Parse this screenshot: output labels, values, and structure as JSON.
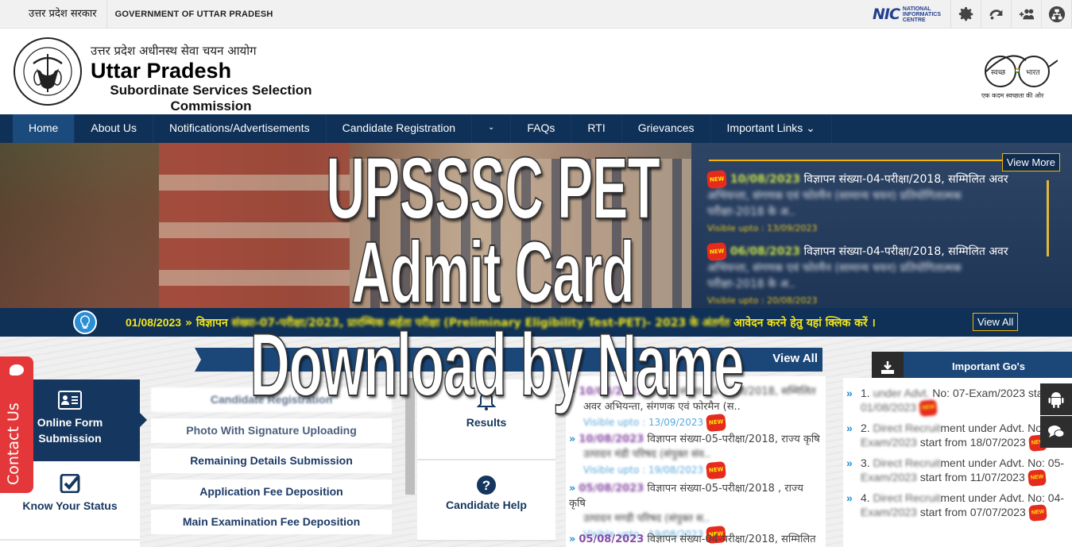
{
  "gov_bar": {
    "hindi": "उत्तर प्रदेश सरकार",
    "english": "GOVERNMENT OF UTTAR PRADESH",
    "nic_mark": "NIC",
    "nic_text": [
      "NATIONAL",
      "INFORMATICS",
      "CENTRE"
    ],
    "tools": [
      "settings-icon",
      "skip-to-content-icon",
      "add-user-icon",
      "sitemap-icon"
    ]
  },
  "header": {
    "hindi_title": "उत्तर प्रदेश अधीनस्थ सेवा चयन आयोग",
    "title": "Uttar Pradesh",
    "subtitle": "Subordinate Services Selection Commission",
    "emblem_text": "उत्तर प्रदेश सरकार",
    "swachh": {
      "left": "स्वच्छ",
      "right": "भारत",
      "tagline": "एक कदम स्वच्छता की ओर"
    }
  },
  "nav": {
    "items": [
      {
        "label": "Home",
        "active": true
      },
      {
        "label": "About Us"
      },
      {
        "label": "Notifications/Advertisements"
      },
      {
        "label": "Candidate Registration"
      },
      {
        "label": "⌄"
      },
      {
        "label": "FAQs"
      },
      {
        "label": "RTI"
      },
      {
        "label": "Grievances"
      },
      {
        "label": "Important Links ⌄"
      }
    ]
  },
  "banner": {
    "view_more": "View More",
    "news": [
      {
        "date": "10/08/2023",
        "text": "विज्ञापन संख्या-04-परीक्षा/2018, सम्मिलित अवर",
        "text2": "अभियन्ता, संगणक एवं फोरमैन (सामान्य चयन) प्रतियोगितात्मक",
        "text3": "परीक्षा-2018 के अ..",
        "visible": "Visible upto : 13/09/2023",
        "badge": "NEW"
      },
      {
        "date": "06/08/2023",
        "text": "विज्ञापन संख्या-04-परीक्षा/2018, सम्मिलित अवर",
        "text2": "अभियन्ता, संगणक एवं फोरमैन (सामान्य चयन) प्रतियोगितात्मक",
        "text3": "परीक्षा-2018 के अ..",
        "visible": "Visible upto : 20/08/2023",
        "badge": "NEW"
      }
    ]
  },
  "ticker": {
    "date": "01/08/2023",
    "sep": "»",
    "text_start": "विज्ञापन",
    "text_blur": "संख्या-07-परीक्षा/2023, प्रारम्भिक अर्हता परीक्षा (Preliminary Eligibility Test-PET)- 2023 के अंतर्गत",
    "text_end": "आवेदन करने हेतु यहां क्लिक करें ।",
    "view_all": "View All"
  },
  "contact": {
    "label": "Contact Us"
  },
  "tabs": [
    {
      "label_line1": "Online Form",
      "label_line2": "Submission",
      "icon": "id-card-icon",
      "active": true
    },
    {
      "label_line1": "Know Your Status",
      "label_line2": "",
      "icon": "checkbox-icon"
    }
  ],
  "submenu": [
    "Candidate Registration",
    "Photo With Signature Uploading",
    "Remaining Details Submission",
    "Application Fee Deposition",
    "Main Examination Fee Deposition"
  ],
  "cards": [
    {
      "label": "Results",
      "icon": "bell-icon"
    },
    {
      "label": "Candidate Help",
      "icon": "question-icon"
    }
  ],
  "notices": {
    "view_all": "View All",
    "items": [
      {
        "date": "10/08/2023",
        "text": "विज्ञापन संख्या-04-परीक्षा/2018, सम्मिलित",
        "text2": "अवर अभियन्ता, संगणक एवं फोरमैन (स..",
        "visible_label": "Visible upto :",
        "visible_date": "13/09/2023",
        "badge": "NEW"
      },
      {
        "date": "10/08/2023",
        "text": "विज्ञापन संख्या-05-परीक्षा/2018, राज्य कृषि",
        "text2": "उत्पादन मंडी परिषद (संपुक्त संव..",
        "visible_label": "Visible upto :",
        "visible_date": "19/08/2023",
        "badge": "NEW"
      },
      {
        "date": "05/08/2023",
        "text": "विज्ञापन संख्या-05-परीक्षा/2018 , राज्य कृषि",
        "text2": "उत्पादन मण्डी परिषद (संपुक्त स..",
        "visible_label": "Visible upto :",
        "visible_date": "19/08/2023",
        "badge": "NEW"
      },
      {
        "date": "05/08/2023",
        "text": "विज्ञापन संख्या-04-परीक्षा/2018, सम्मिलित",
        "text2": "",
        "visible_label": "",
        "visible_date": "",
        "badge": ""
      }
    ]
  },
  "important_gos": {
    "title": "Important Go's",
    "items": [
      {
        "num": "1.",
        "blur": "under Advt.",
        "text": "No: 07-Exam/2023 start",
        "line2_blur": "01/08/2023",
        "line2": "",
        "badge": "NEW"
      },
      {
        "num": "2.",
        "blur": "Direct Recruit",
        "text": "ment under Advt. No: 06-",
        "line2_blur": "Exam/2023",
        "line2": "start from 18/07/2023",
        "badge": "NEW"
      },
      {
        "num": "3.",
        "blur": "Direct Recruit",
        "text": "ment under Advt. No: 05-",
        "line2_blur": "Exam/2023",
        "line2": "start from 11/07/2023",
        "badge": "NEW"
      },
      {
        "num": "4.",
        "blur": "Direct Recruit",
        "text": "ment under Advt. No: 04-",
        "line2_blur": "Exam/2023",
        "line2": "start from 07/07/2023",
        "badge": "NEW"
      }
    ]
  },
  "side_buttons": [
    "android-icon",
    "chat-icon"
  ],
  "overlay_title": {
    "line1": "UPSSSC PET",
    "line2": "Admit Card",
    "line3": "Download by Name"
  }
}
